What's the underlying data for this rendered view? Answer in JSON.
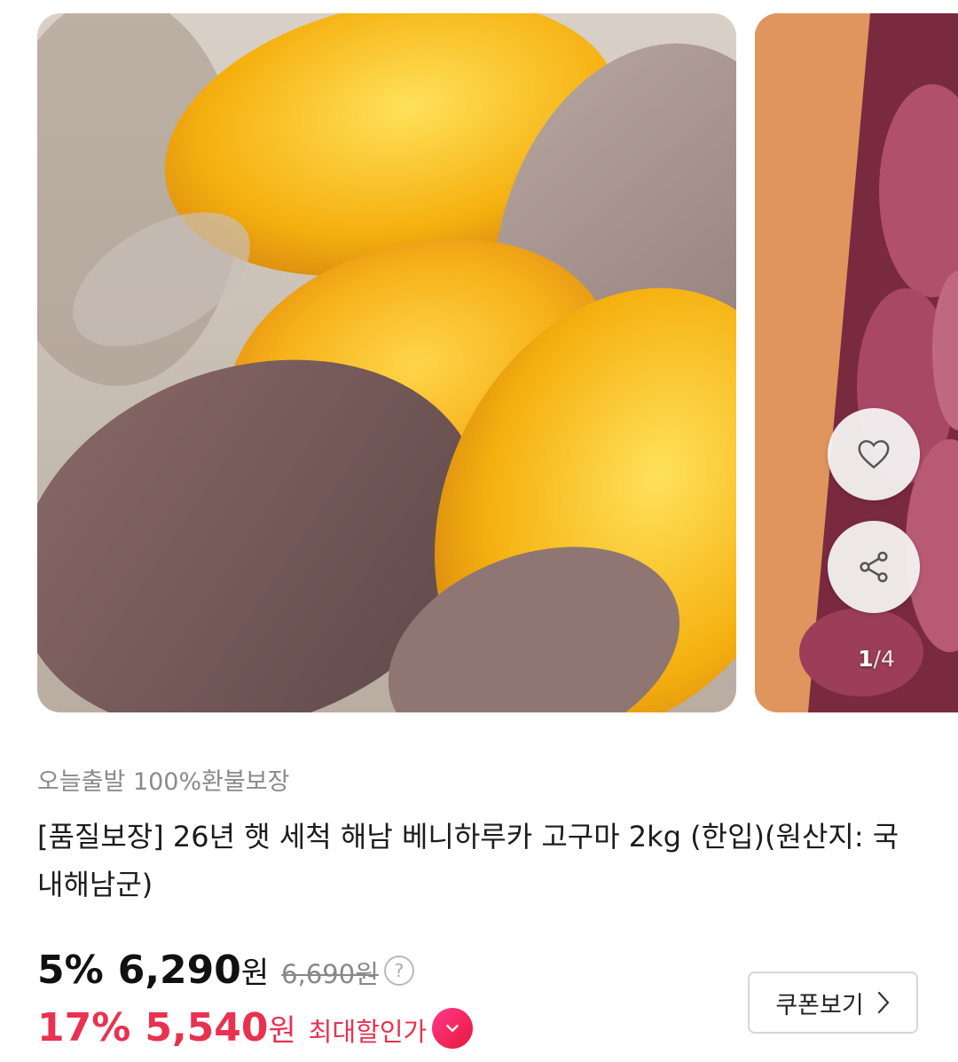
{
  "gallery": {
    "pager_current": "1",
    "pager_total": "/4",
    "main_image": "roasted-sweet-potatoes-photo",
    "next_image": "sweet-potatoes-in-box-photo"
  },
  "product": {
    "subtitle": "오늘출발 100%환불보장",
    "title": "[품질보장] 26년 햇 세척 해남 베니하루카 고구마 2kg (한입)(원산지: 국내해남군)"
  },
  "price": {
    "discount_rate": "5%",
    "sale_price": "6,290",
    "currency": "원",
    "original_price": "6,690원",
    "help_icon": "?",
    "max_discount_rate": "17%",
    "max_price": "5,540",
    "max_label": "최대할인가"
  },
  "coupon": {
    "label": "쿠폰보기"
  },
  "colors": {
    "accent": "#e8324f",
    "muted": "#8a8a8a"
  }
}
